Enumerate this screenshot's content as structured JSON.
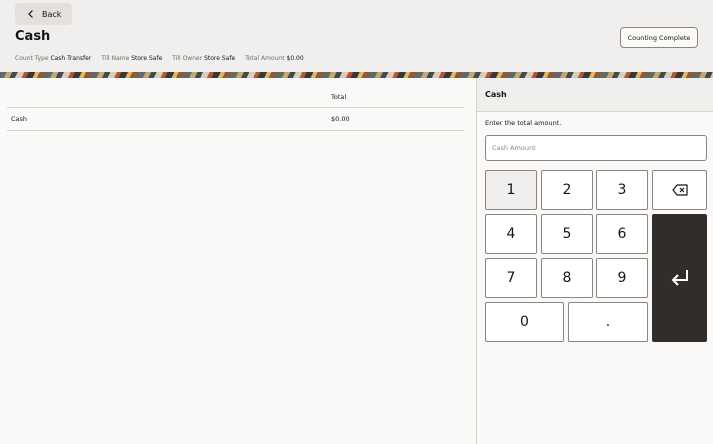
{
  "header": {
    "back_label": "Back",
    "title": "Cash",
    "complete_label": "Counting Complete",
    "meta": [
      {
        "label": "Count Type",
        "value": "Cash Transfer"
      },
      {
        "label": "Till Name",
        "value": "Store Safe"
      },
      {
        "label": "Till Owner",
        "value": "Store Safe"
      },
      {
        "label": "Total Amount",
        "value": "$0.00"
      }
    ]
  },
  "table": {
    "columns": [
      "",
      "Total"
    ],
    "rows": [
      {
        "name": "Cash",
        "total": "$0.00"
      }
    ]
  },
  "panel": {
    "title": "Cash",
    "instruction": "Enter the total amount.",
    "input_placeholder": "Cash Amount",
    "input_value": ""
  },
  "keypad": {
    "keys": [
      "1",
      "2",
      "3",
      "4",
      "5",
      "6",
      "7",
      "8",
      "9",
      "0",
      "."
    ],
    "backspace_icon": "backspace-icon",
    "enter_icon": "enter-icon"
  },
  "colors": {
    "enter_key": "#312d2a",
    "header_bg": "#f1efed",
    "border": "#8b8580"
  }
}
